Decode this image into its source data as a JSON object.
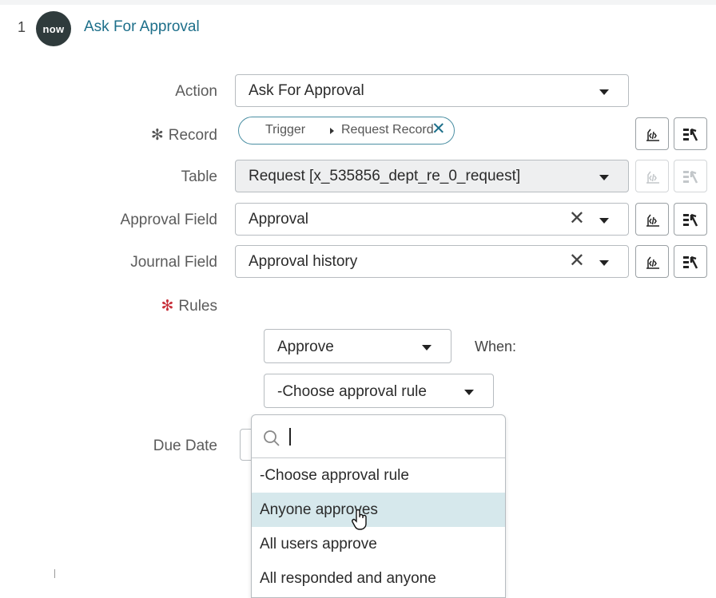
{
  "step": {
    "number": "1",
    "logo_text": "now",
    "title": "Ask For Approval"
  },
  "form": {
    "action": {
      "label": "Action",
      "value": "Ask For Approval"
    },
    "record": {
      "label": "Record",
      "pill_part1": "Trigger",
      "pill_part2": "Request Record"
    },
    "table": {
      "label": "Table",
      "value": "Request [x_535856_dept_re_0_request]"
    },
    "approval_field": {
      "label": "Approval Field",
      "value": "Approval"
    },
    "journal_field": {
      "label": "Journal Field",
      "value": "Approval history"
    },
    "rules": {
      "label": "Rules",
      "action_select": "Approve",
      "when_label": "When:",
      "rule_select": "-Choose approval rule"
    },
    "due_date": {
      "label": "Due Date"
    }
  },
  "dropdown": {
    "search_value": "",
    "options": [
      {
        "label": "-Choose approval rule",
        "highlighted": false
      },
      {
        "label": "Anyone approves",
        "highlighted": true
      },
      {
        "label": "All users approve",
        "highlighted": false
      },
      {
        "label": "All responded and anyone",
        "highlighted": false
      }
    ]
  },
  "colors": {
    "accent": "#1d6f8a",
    "required_star": "#c8323c",
    "highlight_row": "#d6e8ec",
    "logo_bg": "#2f3b3c"
  },
  "icons": {
    "data_pill_picker": "data-pill-picker-icon",
    "script_toggle": "script-toggle-icon",
    "search": "search-icon",
    "cursor": "hand-pointer-icon"
  }
}
